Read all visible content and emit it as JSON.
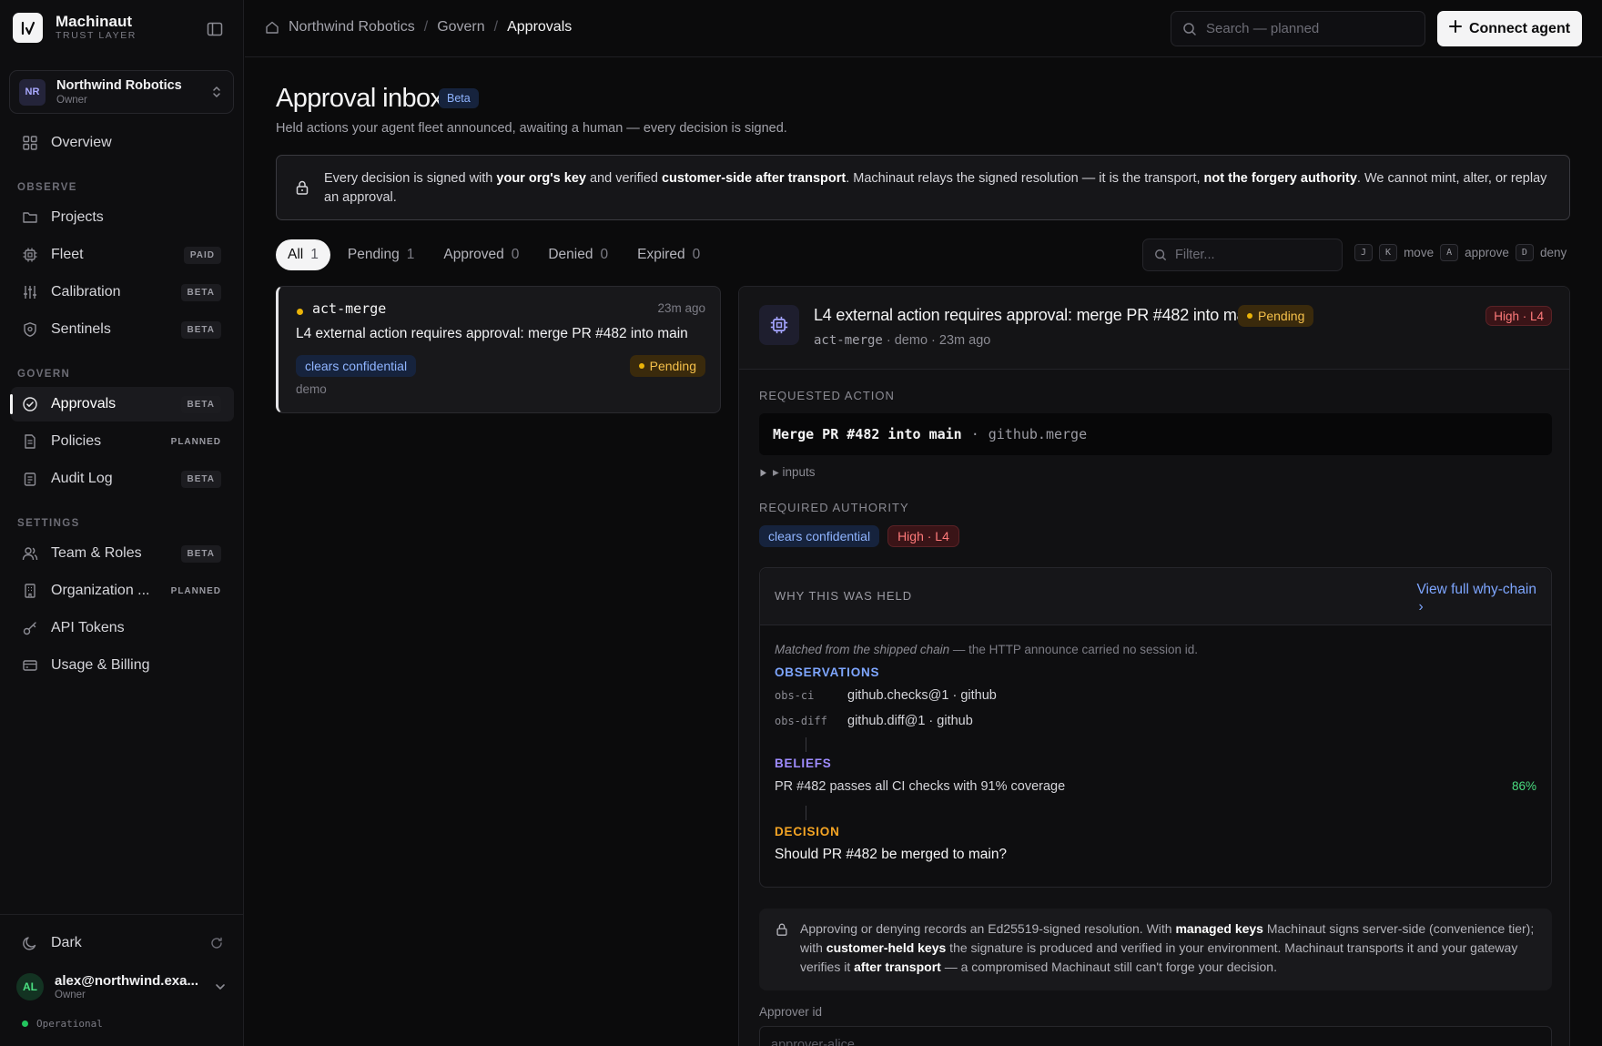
{
  "brand": {
    "name": "Machinaut",
    "subtitle": "TRUST LAYER"
  },
  "org": {
    "initials": "NR",
    "name": "Northwind Robotics",
    "role": "Owner"
  },
  "nav": {
    "overview": {
      "label": "Overview"
    },
    "observe_title": "OBSERVE",
    "observe": [
      {
        "label": "Projects",
        "badge": ""
      },
      {
        "label": "Fleet",
        "badge": "PAID"
      },
      {
        "label": "Calibration",
        "badge": "BETA"
      },
      {
        "label": "Sentinels",
        "badge": "BETA"
      }
    ],
    "govern_title": "GOVERN",
    "govern": [
      {
        "label": "Approvals",
        "badge": "BETA"
      },
      {
        "label": "Policies",
        "badge": "PLANNED"
      },
      {
        "label": "Audit Log",
        "badge": "BETA"
      }
    ],
    "settings_title": "SETTINGS",
    "settings": [
      {
        "label": "Team & Roles",
        "badge": "BETA"
      },
      {
        "label": "Organization ...",
        "badge": "PLANNED"
      },
      {
        "label": "API Tokens",
        "badge": ""
      },
      {
        "label": "Usage & Billing",
        "badge": ""
      }
    ]
  },
  "theme": {
    "label": "Dark"
  },
  "user": {
    "initials": "AL",
    "email": "alex@northwind.exa...",
    "role": "Owner"
  },
  "system_status": "Operational",
  "breadcrumb": [
    "Northwind Robotics",
    "Govern",
    "Approvals"
  ],
  "search": {
    "placeholder": "Search — planned"
  },
  "connect_button": "Connect agent",
  "page": {
    "title": "Approval inbox",
    "badge": "Beta",
    "subtitle": "Held actions your agent fleet announced, awaiting a human — every decision is signed."
  },
  "notice": {
    "t1": "Every decision is signed with ",
    "b1": "your org's key",
    "t2": " and verified ",
    "b2": "customer-side after transport",
    "t3": ". Machinaut relays the signed resolution — it is the transport, ",
    "b3": "not the forgery authority",
    "t4": ". We cannot mint, alter, or replay an approval."
  },
  "tabs": [
    {
      "label": "All",
      "count": "1"
    },
    {
      "label": "Pending",
      "count": "1"
    },
    {
      "label": "Approved",
      "count": "0"
    },
    {
      "label": "Denied",
      "count": "0"
    },
    {
      "label": "Expired",
      "count": "0"
    }
  ],
  "filter": {
    "placeholder": "Filter..."
  },
  "shortcuts": {
    "k1": "J",
    "k2": "K",
    "move": "move",
    "k3": "A",
    "approve": "approve",
    "k4": "D",
    "deny": "deny"
  },
  "list": [
    {
      "id": "act-merge",
      "time": "23m ago",
      "title": "L4 external action requires approval: merge PR #482 into main",
      "tag": "clears confidential",
      "status": "Pending",
      "env": "demo"
    }
  ],
  "detail": {
    "title": "L4 external action requires approval: merge PR #482 into main",
    "status": "Pending",
    "risk": "High · L4",
    "meta_id": "act-merge",
    "meta_rest": " · demo · 23m ago",
    "requested_label": "REQUESTED ACTION",
    "action_main": "Merge PR #482 into main",
    "action_sep": "·",
    "action_op": "github.merge",
    "inputs_label": "▸ inputs",
    "authority_label": "REQUIRED AUTHORITY",
    "authority_tag": "clears confidential",
    "authority_risk": "High · L4",
    "why": {
      "title": "WHY THIS WAS HELD",
      "link_line1": "View full why-chain",
      "link_line2": "›",
      "note_italic": "Matched from the shipped chain",
      "note_rest": " — the HTTP announce carried no session id.",
      "obs_label": "OBSERVATIONS",
      "observations": [
        {
          "id": "obs-ci",
          "text": "github.checks@1 · github"
        },
        {
          "id": "obs-diff",
          "text": "github.diff@1 · github"
        }
      ],
      "beliefs_label": "BELIEFS",
      "belief_text": "PR #482 passes all CI checks with 91% coverage",
      "belief_pct": "86%",
      "decision_label": "DECISION",
      "decision_text": "Should PR #482 be merged to main?"
    },
    "sign": {
      "t1": "Approving or denying records an Ed25519-signed resolution. With ",
      "b1": "managed keys",
      "t2": " Machinaut signs server-side (convenience tier); with ",
      "b2": "customer-held keys",
      "t3": " the signature is produced and verified in your environment. Machinaut transports it and your gateway verifies it ",
      "b3": "after transport",
      "t4": " — a compromised Machinaut still can't forge your decision."
    },
    "approver": {
      "label": "Approver id",
      "placeholder": "approver-alice"
    }
  },
  "colors": {
    "accent_blue": "#7ea6ff",
    "pending_amber": "#eab308",
    "risk_red": "#ff7a7a",
    "operational_green": "#22c55e"
  }
}
